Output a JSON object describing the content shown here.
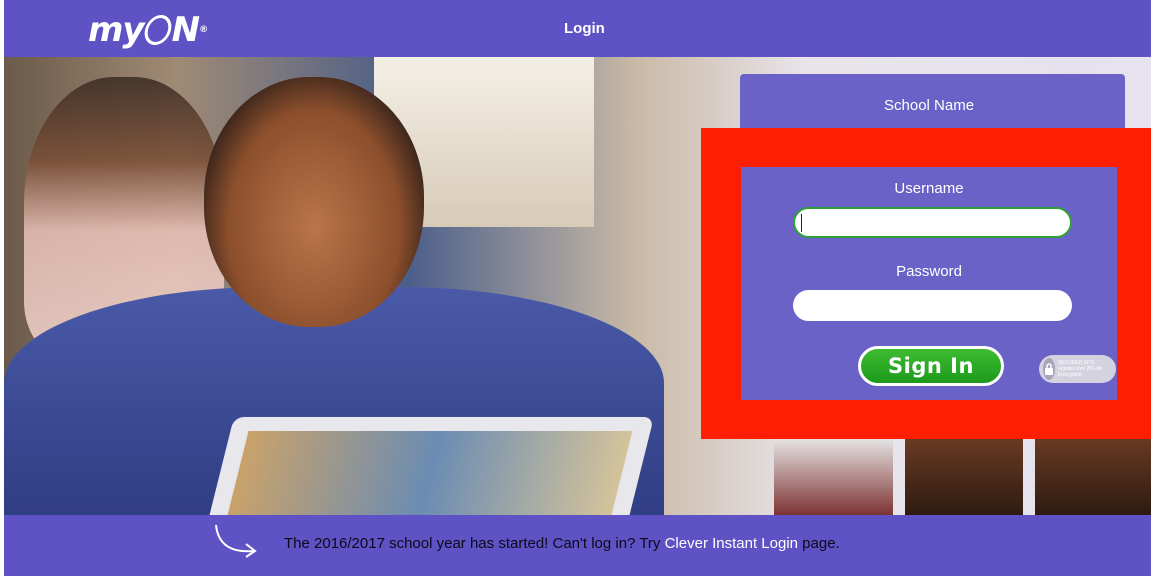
{
  "header": {
    "logo_text_left": "my",
    "logo_text_right": "N",
    "logo_reg": "®",
    "title": "Login"
  },
  "login": {
    "school_label": "School Name",
    "username_label": "Username",
    "username_value": "",
    "password_label": "Password",
    "password_value": "",
    "signin_label": "Sign In",
    "secured_badge_text": "SECURED SITE register.com 256-bit Encryption"
  },
  "footer": {
    "message_prefix": "The 2016/2017 school year has started! Can't log in? Try ",
    "link_text": "Clever Instant Login",
    "message_suffix": " page."
  },
  "colors": {
    "header_bg": "#5e52c4",
    "panel_bg": "#6b62c8",
    "highlight_box": "#ff1e00",
    "signin_green": "#2aa82a"
  },
  "icons": [
    "arrow-icon",
    "lock-icon"
  ]
}
